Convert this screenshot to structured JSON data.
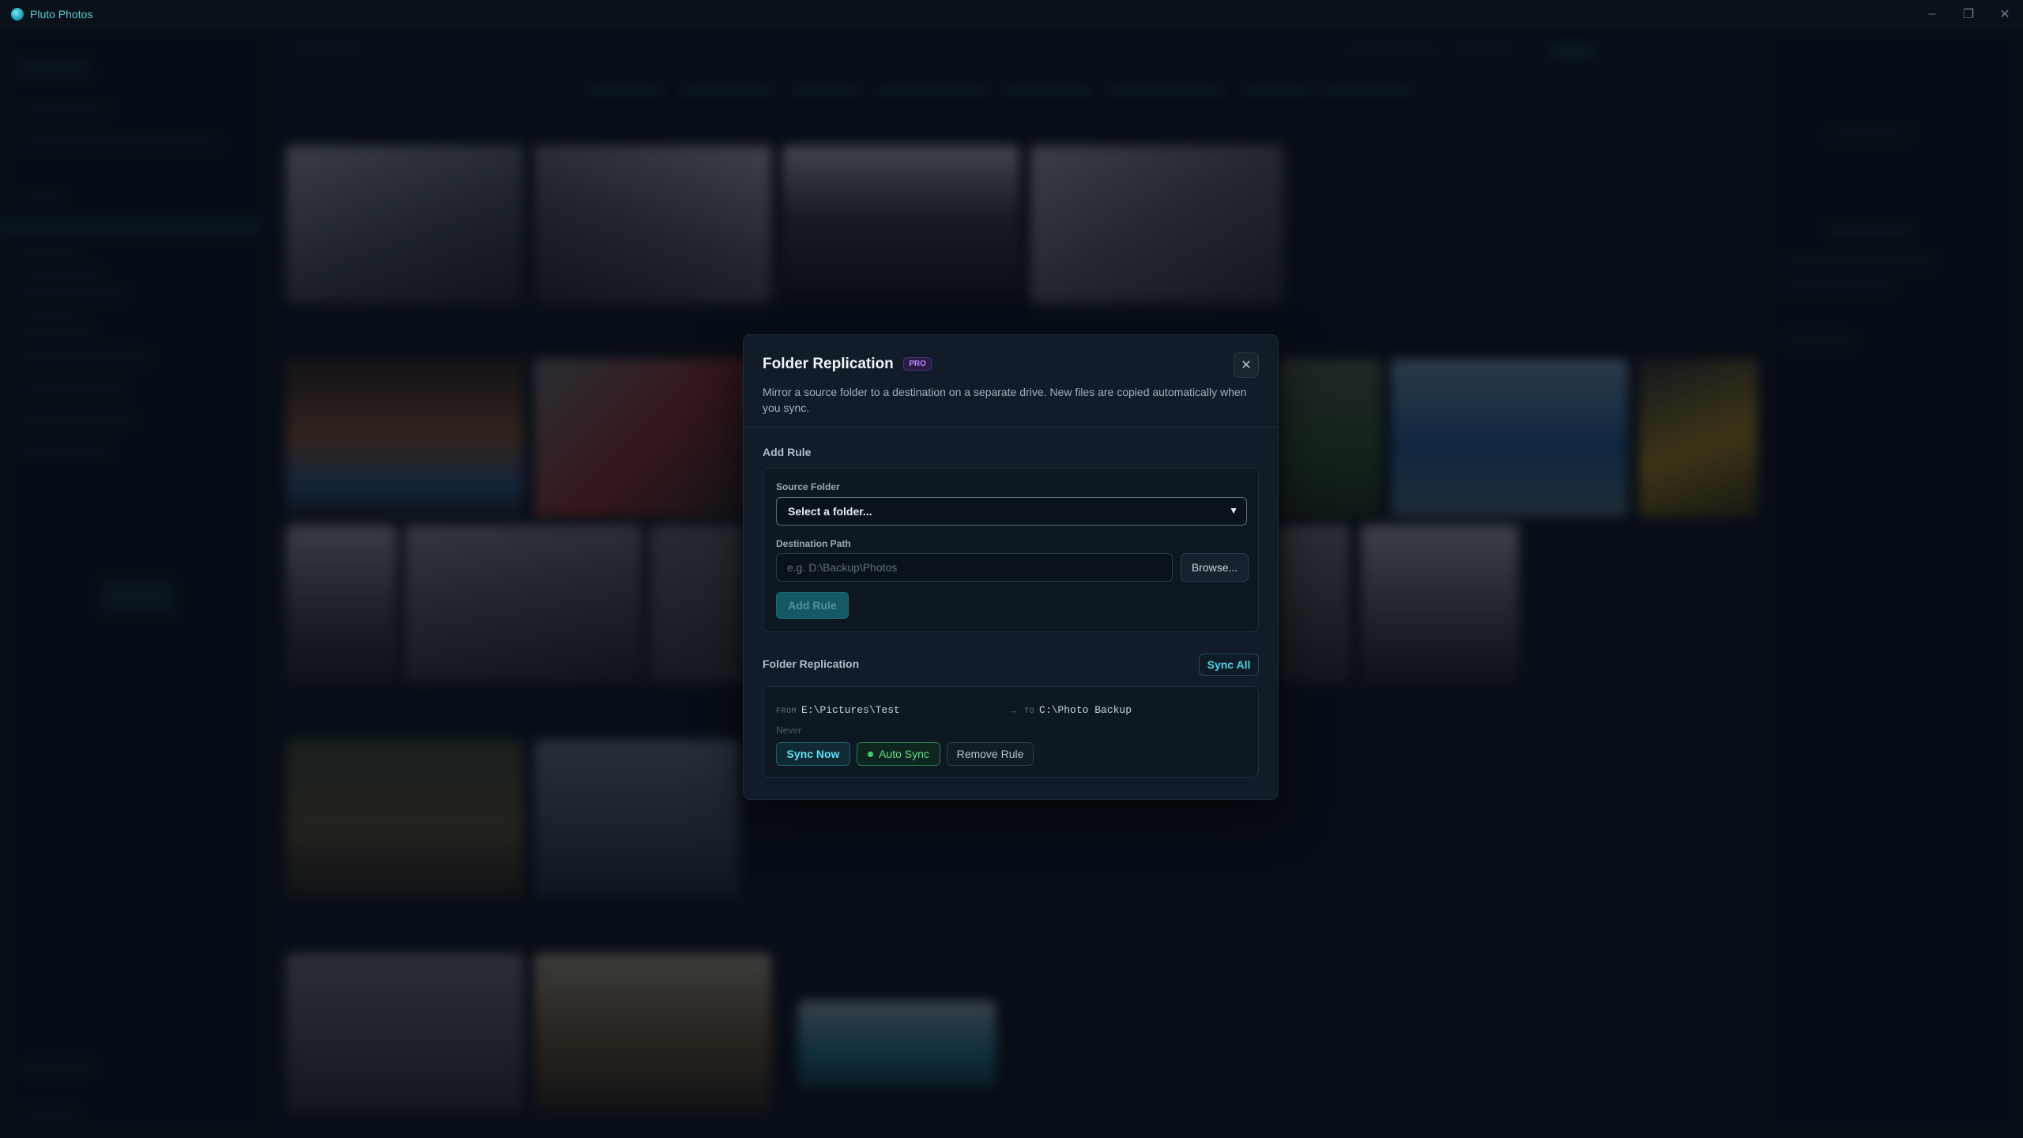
{
  "window": {
    "title": "Pluto Photos",
    "controls": {
      "minimize": "–",
      "maximize": "❐",
      "close": "✕"
    }
  },
  "modal": {
    "title": "Folder Replication",
    "badge": "PRO",
    "close_glyph": "✕",
    "description": "Mirror a source folder to a destination on a separate drive. New files are copied automatically when you sync.",
    "add_rule": {
      "section_label": "Add Rule",
      "source_label": "Source Folder",
      "source_value": "Select a folder...",
      "destination_label": "Destination Path",
      "destination_placeholder": "e.g. D:\\Backup\\Photos",
      "browse_label": "Browse...",
      "add_button_label": "Add Rule"
    },
    "rules": {
      "section_label": "Folder Replication",
      "sync_all_label": "Sync All",
      "items": [
        {
          "from_key": "FROM",
          "from": "E:\\Pictures\\Test",
          "arrow": "→",
          "to_key": "TO",
          "to": "C:\\Photo Backup",
          "last_sync": "Never",
          "sync_now_label": "Sync Now",
          "auto_sync_label": "Auto Sync",
          "remove_label": "Remove Rule"
        }
      ]
    }
  },
  "colors": {
    "accent": "#4fd3e6",
    "pro": "#c084fc",
    "auto_sync": "#3ed26e",
    "background": "#0d1520",
    "modal": "#111c28"
  }
}
